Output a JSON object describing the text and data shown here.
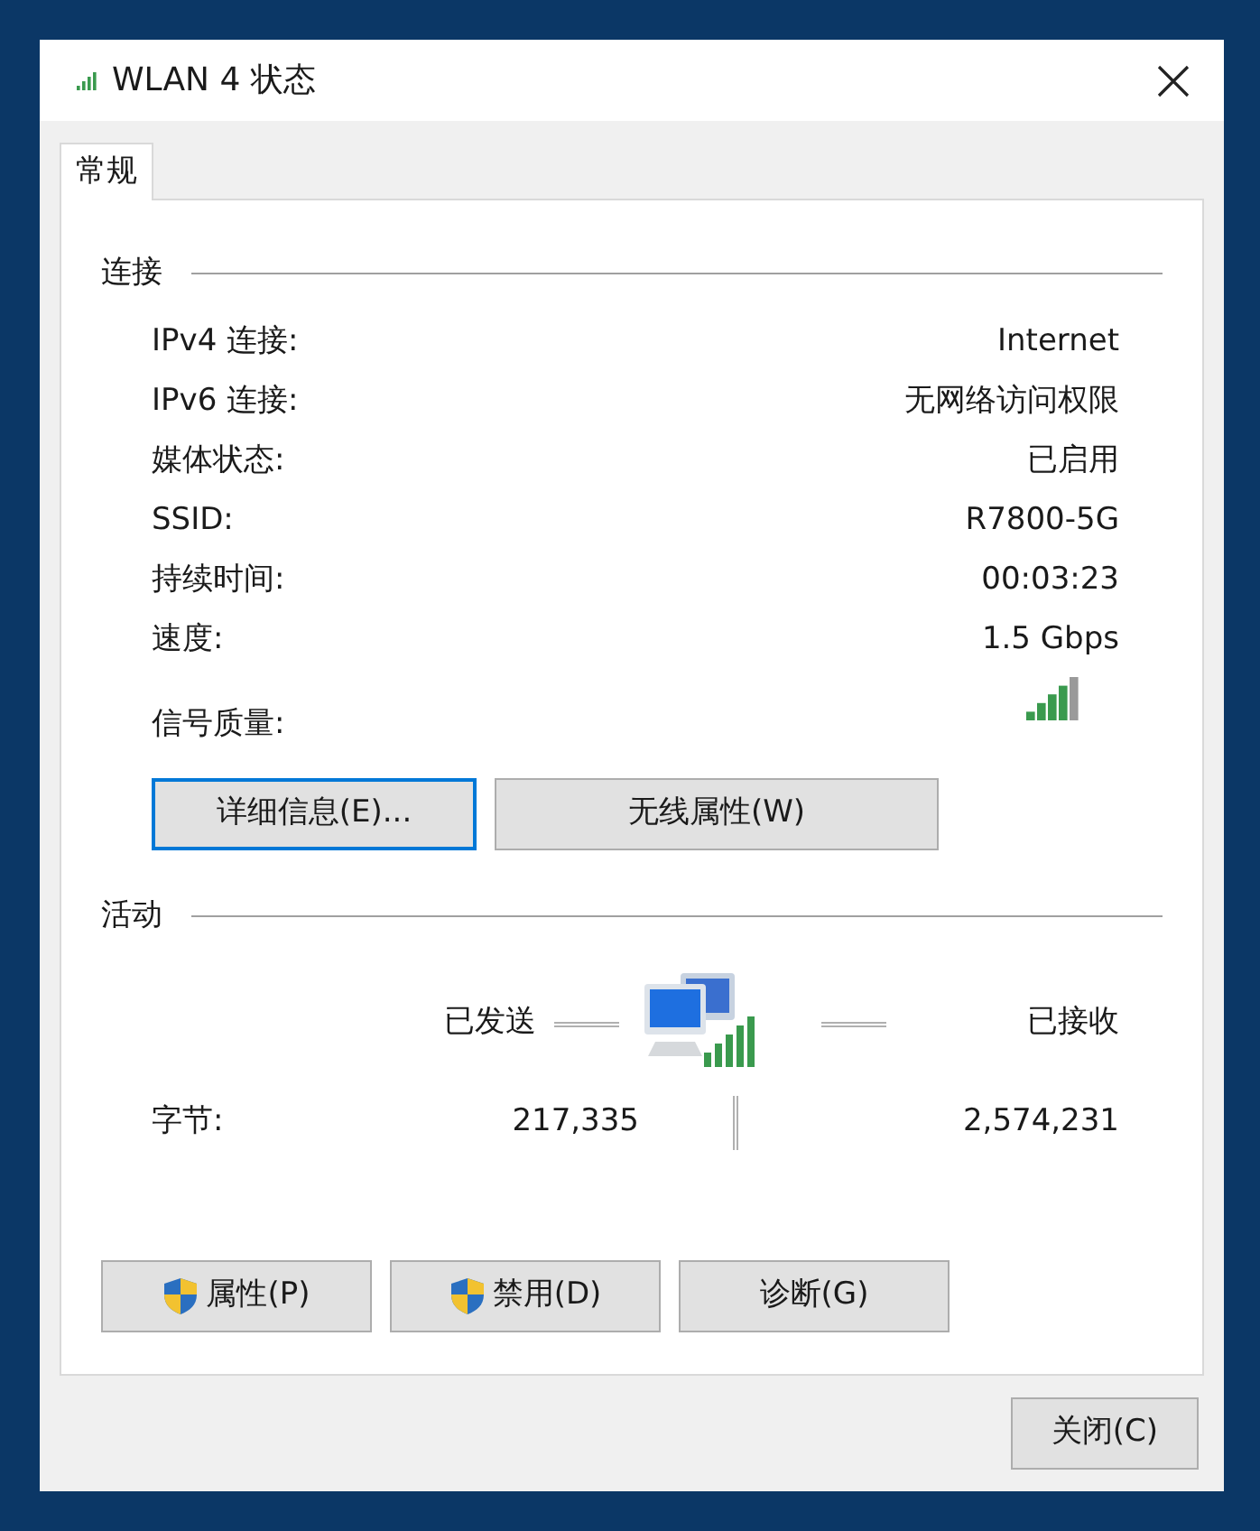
{
  "window": {
    "title": "WLAN 4 状态"
  },
  "tabs": [
    {
      "label": "常规",
      "selected": true
    }
  ],
  "connection": {
    "heading": "连接",
    "rows": [
      {
        "label": "IPv4 连接:",
        "value": "Internet"
      },
      {
        "label": "IPv6 连接:",
        "value": "无网络访问权限"
      },
      {
        "label": "媒体状态:",
        "value": "已启用"
      },
      {
        "label": "SSID:",
        "value": "R7800-5G"
      },
      {
        "label": "持续时间:",
        "value": "00:03:23"
      },
      {
        "label": "速度:",
        "value": "1.5 Gbps"
      }
    ],
    "signal_label": "信号质量:",
    "buttons": [
      {
        "label": "详细信息(E)...",
        "focused": true
      },
      {
        "label": "无线属性(W)",
        "focused": false
      }
    ]
  },
  "activity": {
    "heading": "活动",
    "sent_label": "已发送",
    "received_label": "已接收",
    "bytes_label": "字节:",
    "sent": "217,335",
    "received": "2,574,231",
    "buttons": [
      {
        "label": "属性(P)",
        "shield": true
      },
      {
        "label": "禁用(D)",
        "shield": true
      },
      {
        "label": "诊断(G)",
        "shield": false
      }
    ]
  },
  "footer_buttons": [
    {
      "label": "关闭(C)"
    }
  ]
}
